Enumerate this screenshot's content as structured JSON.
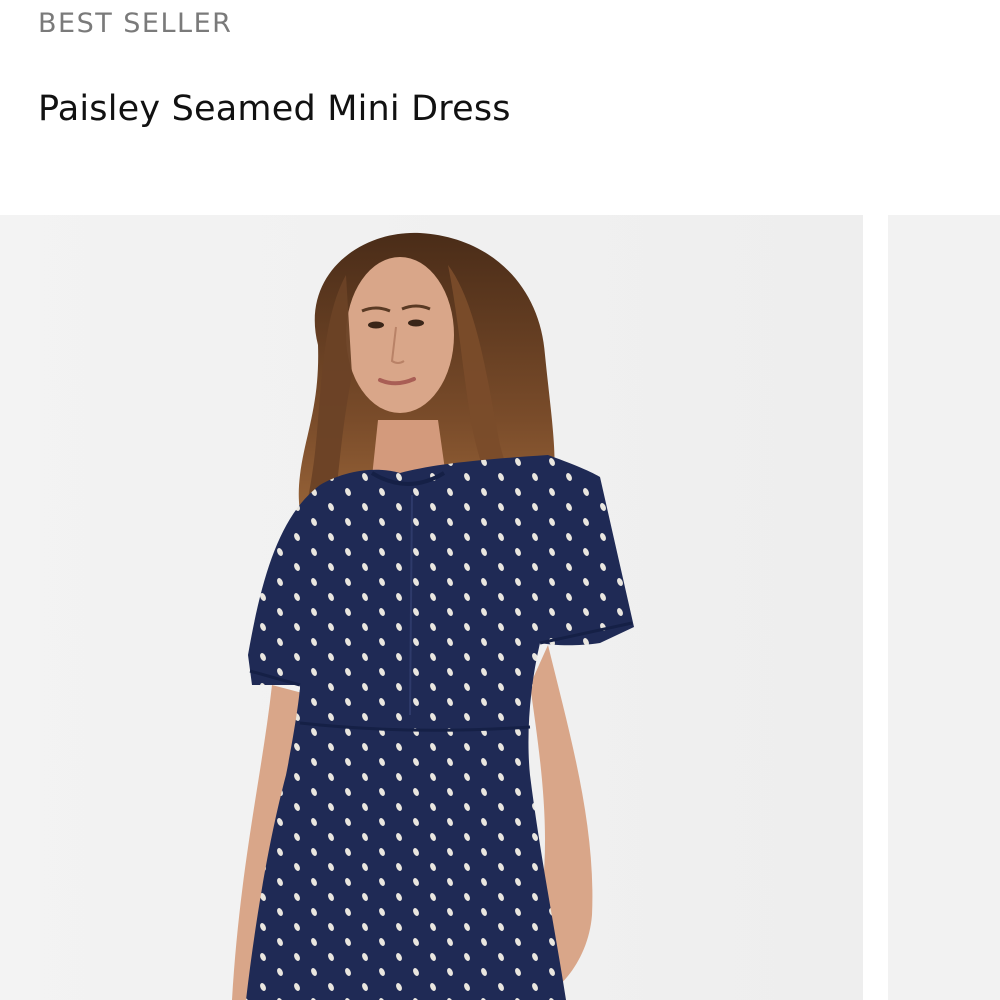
{
  "product": {
    "badge": "BEST SELLER",
    "title": "Paisley Seamed Mini Dress"
  },
  "gallery": {
    "images": [
      {
        "alt": "Model wearing navy paisley seamed mini dress with short sleeves"
      },
      {
        "alt": "Next product image (partially visible)"
      }
    ]
  },
  "colors": {
    "background": "#ffffff",
    "image_background": "#f1f1f1",
    "badge_text": "#7a7a7a",
    "title_text": "#111111",
    "dress_navy": "#1f2a55",
    "dress_print": "#e9e6df",
    "hair": "#6b4226",
    "skin": "#d9a689"
  }
}
